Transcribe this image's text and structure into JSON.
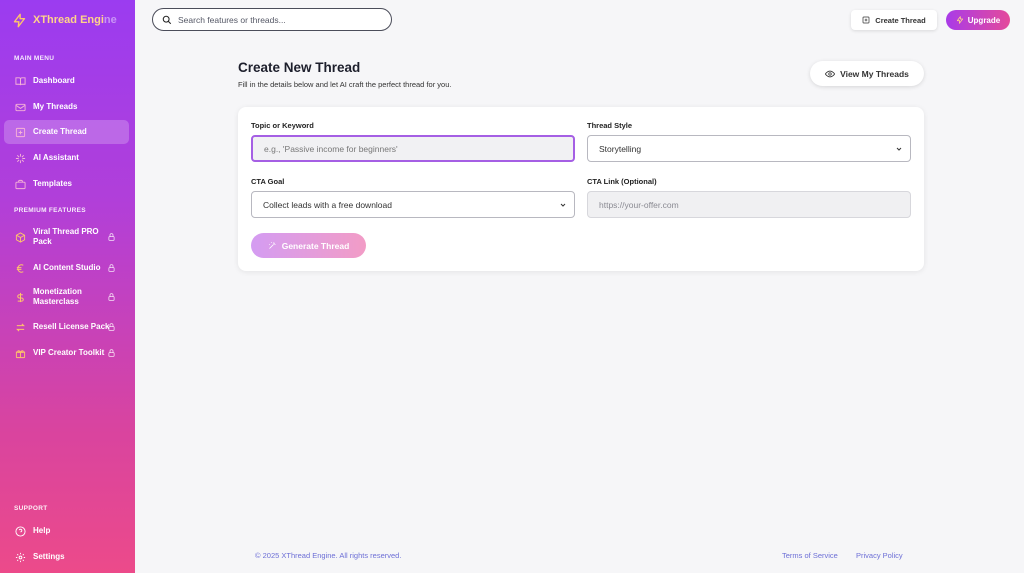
{
  "brand": {
    "name_main": "XThread Engi",
    "name_fade": "ne"
  },
  "sidebar": {
    "main_menu_label": "MAIN MENU",
    "main_items": [
      {
        "label": "Dashboard",
        "icon": "book-open-icon"
      },
      {
        "label": "My Threads",
        "icon": "mail-icon"
      },
      {
        "label": "Create Thread",
        "icon": "plus-square-icon",
        "active": true
      },
      {
        "label": "AI Assistant",
        "icon": "sparkle-icon"
      },
      {
        "label": "Templates",
        "icon": "briefcase-icon"
      }
    ],
    "premium_label": "PREMIUM FEATURES",
    "premium_items": [
      {
        "label": "Viral Thread PRO Pack",
        "icon": "box-icon"
      },
      {
        "label": "AI Content Studio",
        "icon": "euro-icon"
      },
      {
        "label": "Monetization Masterclass",
        "icon": "dollar-icon"
      },
      {
        "label": "Resell License Pack",
        "icon": "swap-arrows-icon"
      },
      {
        "label": "VIP Creator Toolkit",
        "icon": "gift-icon"
      }
    ],
    "support_label": "SUPPORT",
    "support_items": [
      {
        "label": "Help",
        "icon": "help-circle-icon"
      },
      {
        "label": "Settings",
        "icon": "gear-icon"
      }
    ]
  },
  "topbar": {
    "search_placeholder": "Search features or threads...",
    "create_label": "Create Thread",
    "upgrade_label": "Upgrade"
  },
  "page": {
    "title": "Create New Thread",
    "subtitle": "Fill in the details below and let AI craft the perfect thread for you.",
    "view_button": "View My Threads"
  },
  "form": {
    "topic_label": "Topic or Keyword",
    "topic_placeholder": "e.g., 'Passive income for beginners'",
    "style_label": "Thread Style",
    "style_value": "Storytelling",
    "cta_goal_label": "CTA Goal",
    "cta_goal_value": "Collect leads with a free download",
    "cta_link_label": "CTA Link (Optional)",
    "cta_link_placeholder": "https://your-offer.com",
    "generate_label": "Generate Thread"
  },
  "footer": {
    "copyright": "© 2025 XThread Engine. All rights reserved.",
    "terms": "Terms of Service",
    "privacy": "Privacy Policy"
  },
  "colors": {
    "sidebar_top": "#9b3cf0",
    "sidebar_bottom": "#ec4a8a",
    "icon_gold": "#ffc46b",
    "link": "#6d6fd6"
  }
}
